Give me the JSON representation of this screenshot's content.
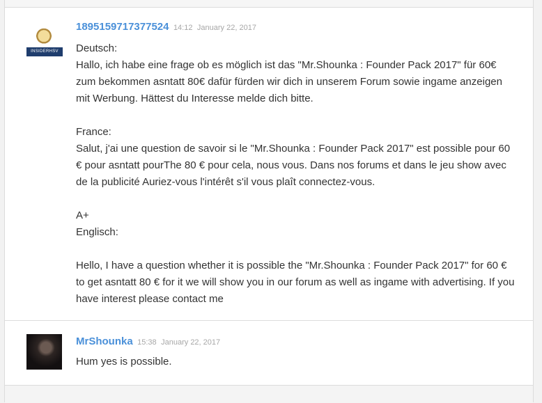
{
  "posts": [
    {
      "author": "1895159717377524",
      "time": "14:12",
      "date": "January 22, 2017",
      "avatar_badge": "INSIDERHSV",
      "body": "Deutsch:\nHallo, ich habe eine frage ob es möglich ist das \"Mr.Shounka : Founder Pack 2017\" für 60€ zum bekommen asntatt 80€ dafür fürden wir dich in unserem Forum sowie ingame anzeigen mit Werbung. Hättest du Interesse melde dich bitte.\n\nFrance:\nSalut, j'ai une question de savoir si le \"Mr.Shounka : Founder Pack 2017\" est possible pour 60 € pour asntatt pourThe 80 € pour cela, nous vous. Dans nos forums et dans le jeu show avec de la publicité Auriez-vous l'intérêt s'il vous plaît connectez-vous.\n\nA+\nEnglisch:\n\nHello, I have a question whether it is possible the \"Mr.Shounka : Founder Pack 2017\" for 60 € to get asntatt 80 € for it we will show you in our forum as well as ingame with advertising. If you have interest please contact me"
    },
    {
      "author": "MrShounka",
      "time": "15:38",
      "date": "January 22, 2017",
      "body": "Hum yes is possible."
    }
  ]
}
